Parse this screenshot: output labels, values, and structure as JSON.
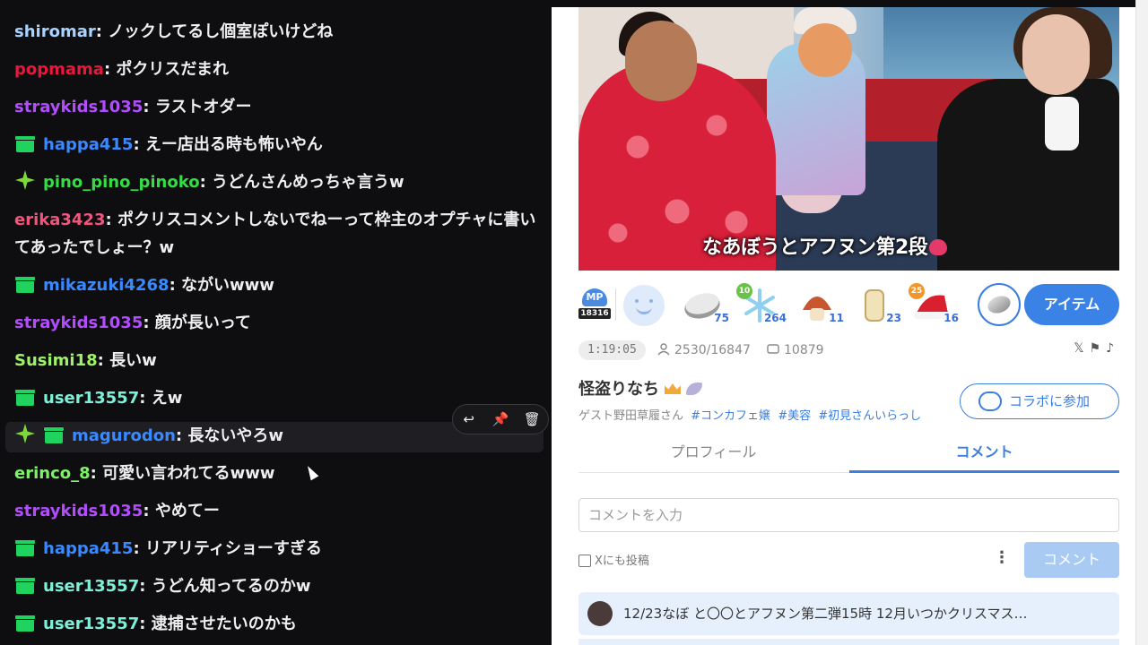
{
  "chat": {
    "messages": [
      {
        "user": "shiromar",
        "color": "#a8d2ff",
        "badges": [],
        "text": "ノックしてるし個室ぽいけどね"
      },
      {
        "user": "popmama",
        "color": "#e8173b",
        "badges": [],
        "text": "ポクリスだまれ"
      },
      {
        "user": "straykids1035",
        "color": "#b24dff",
        "badges": [],
        "text": "ラストオダー"
      },
      {
        "user": "happa415",
        "color": "#3a89ff",
        "badges": [
          "gift"
        ],
        "text": "えー店出る時も怖いやん"
      },
      {
        "user": "pino_pino_pinoko",
        "color": "#33dd44",
        "badges": [
          "spark"
        ],
        "text": "うどんさんめっちゃ言うw"
      },
      {
        "user": "erika3423",
        "color": "#f0557d",
        "badges": [],
        "text": "ポクリスコメントしないでねーって枠主のオプチャに書いてあったでしょー？w"
      },
      {
        "user": "mikazuki4268",
        "color": "#3a89ff",
        "badges": [
          "gift"
        ],
        "text": "ながいwww"
      },
      {
        "user": "straykids1035",
        "color": "#b24dff",
        "badges": [],
        "text": "顔が長いって"
      },
      {
        "user": "Susimi18",
        "color": "#9ff06a",
        "badges": [],
        "text": "長いw"
      },
      {
        "user": "user13557",
        "color": "#7ff0d8",
        "badges": [
          "gift"
        ],
        "text": "えw"
      },
      {
        "user": "magurodon",
        "color": "#3a89ff",
        "badges": [
          "spark",
          "gift"
        ],
        "text": "長ないやろw"
      },
      {
        "user": "erinco_8",
        "color": "#7ff06a",
        "badges": [],
        "text": "可愛い言われてるwww"
      },
      {
        "user": "straykids1035",
        "color": "#b24dff",
        "badges": [],
        "text": "やめてー"
      },
      {
        "user": "happa415",
        "color": "#3a89ff",
        "badges": [
          "gift"
        ],
        "text": "リアリティショーすぎる"
      },
      {
        "user": "user13557",
        "color": "#7ff0d8",
        "badges": [
          "gift"
        ],
        "text": "うどん知ってるのかw"
      },
      {
        "user": "user13557",
        "color": "#7ff0d8",
        "badges": [
          "gift"
        ],
        "text": "逮捕させたいのかも"
      }
    ],
    "actions": {
      "reply_icon": "reply-icon",
      "pin_icon": "pin-icon",
      "delete_icon": "trash-icon"
    }
  },
  "stream": {
    "caption": "なあぼうとアフヌン第2段",
    "mp_label": "MP",
    "mp_points": "18316",
    "items": [
      {
        "name": "coin-item",
        "count": "75",
        "level": ""
      },
      {
        "name": "snowflake-item",
        "count": "264",
        "level": "10"
      },
      {
        "name": "mushroom-item",
        "count": "11",
        "level": ""
      },
      {
        "name": "scroll-item",
        "count": "23",
        "level": ""
      },
      {
        "name": "santa-hat-item",
        "count": "16",
        "level": "25"
      }
    ],
    "item_button": "アイテム",
    "elapsed": "1:19:05",
    "viewers": "2530/16847",
    "comments": "10879",
    "share_icons": [
      "x-icon",
      "flag-icon",
      "music-icon"
    ],
    "title": "怪盗りなち",
    "guest": "ゲスト野田草履さん",
    "tags": [
      "#コンカフェ嬢",
      "#美容",
      "#初見さんいらっし"
    ],
    "collab_button": "コラボに参加",
    "tabs": [
      {
        "label": "プロフィール",
        "active": false
      },
      {
        "label": "コメント",
        "active": true
      }
    ],
    "comment_placeholder": "コメントを入力",
    "x_post_label": "Xにも投稿",
    "send_button": "コメント",
    "notice": "12/23なぼ と〇〇とアフヌン第二弾15時 12月いつかクリスマス…"
  },
  "colors": {
    "accent": "#3a82e6",
    "chat_bg": "#0e0e10"
  }
}
